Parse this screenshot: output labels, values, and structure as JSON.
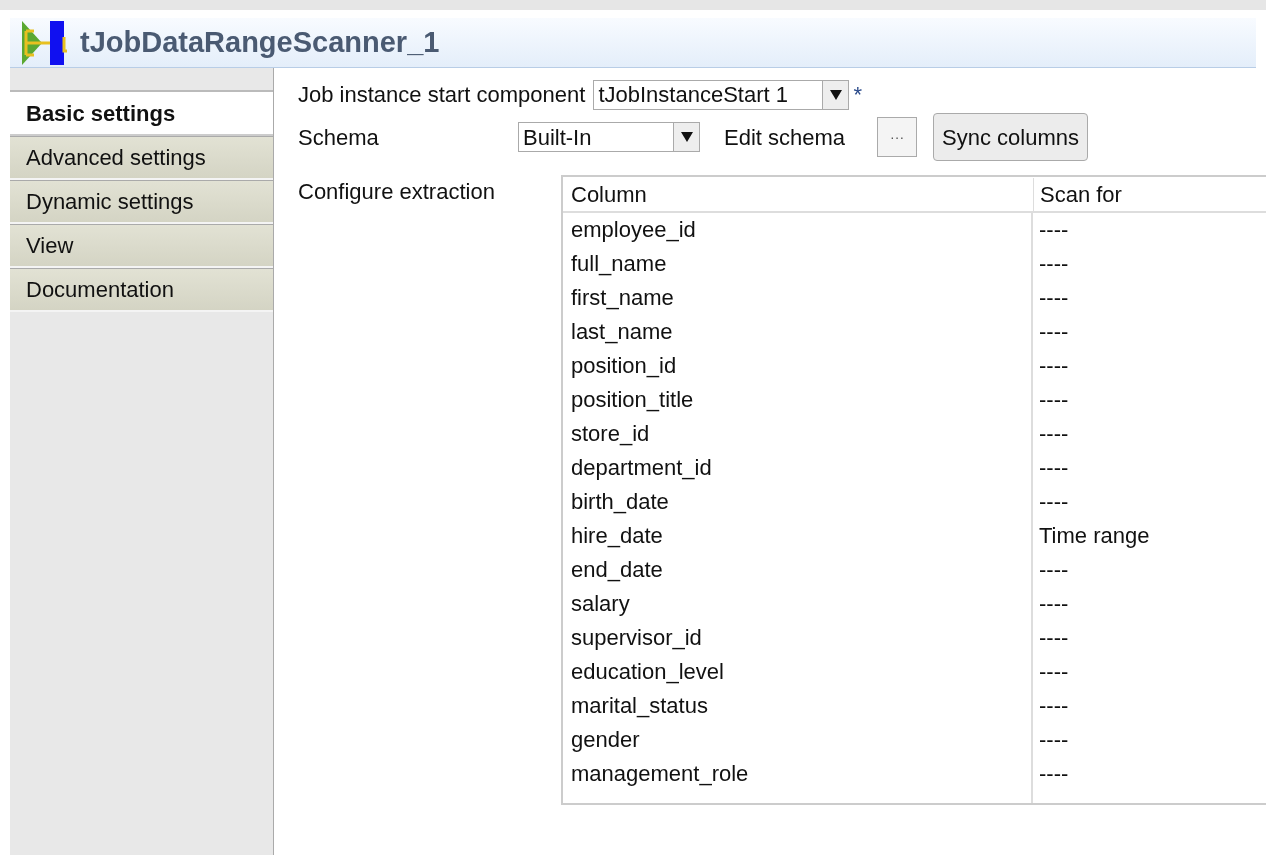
{
  "window": {
    "title": "tJobDataRangeScanner_1"
  },
  "tabs": [
    {
      "label": "Basic settings",
      "selected": true
    },
    {
      "label": "Advanced settings",
      "selected": false
    },
    {
      "label": "Dynamic settings",
      "selected": false
    },
    {
      "label": "View",
      "selected": false
    },
    {
      "label": "Documentation",
      "selected": false
    }
  ],
  "job_instance": {
    "label": "Job instance start component",
    "value": "tJobInstanceStart 1",
    "required_mark": "*"
  },
  "schema": {
    "label": "Schema",
    "value": "Built-In",
    "edit_label": "Edit schema",
    "edit_button": "···",
    "sync_button": "Sync columns"
  },
  "extraction": {
    "label": "Configure extraction",
    "columns": [
      "Column",
      "Scan for"
    ],
    "rows": [
      [
        "employee_id",
        "----"
      ],
      [
        "full_name",
        "----"
      ],
      [
        "first_name",
        "----"
      ],
      [
        "last_name",
        "----"
      ],
      [
        "position_id",
        "----"
      ],
      [
        "position_title",
        "----"
      ],
      [
        "store_id",
        "----"
      ],
      [
        "department_id",
        "----"
      ],
      [
        "birth_date",
        "----"
      ],
      [
        "hire_date",
        "Time range"
      ],
      [
        "end_date",
        "----"
      ],
      [
        "salary",
        "----"
      ],
      [
        "supervisor_id",
        "----"
      ],
      [
        "education_level",
        "----"
      ],
      [
        "marital_status",
        "----"
      ],
      [
        "gender",
        "----"
      ],
      [
        "management_role",
        "----"
      ]
    ]
  }
}
